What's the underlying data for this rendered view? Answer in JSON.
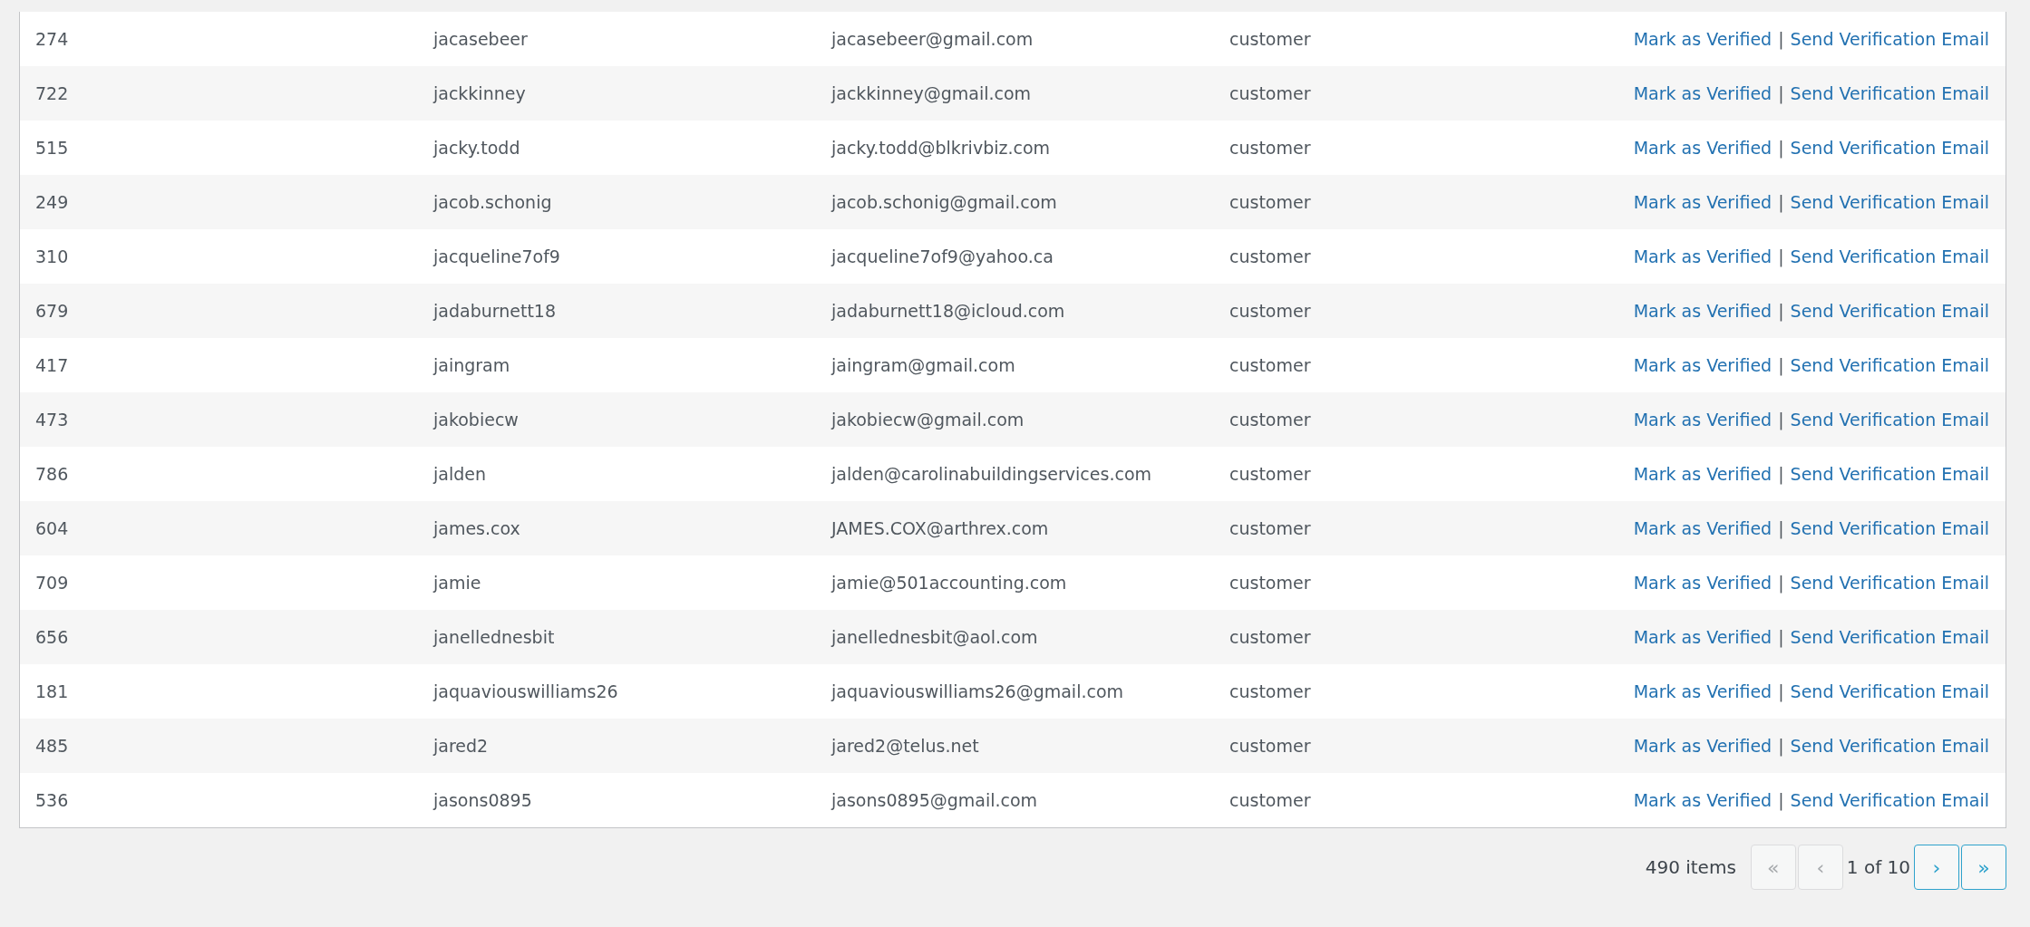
{
  "table": {
    "rows": [
      {
        "id": "274",
        "username": "jacasebeer",
        "email": "jacasebeer@gmail.com",
        "role": "customer",
        "actions": [
          "Mark as Verified",
          "Send Verification Email"
        ],
        "separator": "|"
      },
      {
        "id": "722",
        "username": "jackkinney",
        "email": "jackkinney@gmail.com",
        "role": "customer",
        "actions": [
          "Mark as Verified",
          "Send Verification Email"
        ],
        "separator": "|"
      },
      {
        "id": "515",
        "username": "jacky.todd",
        "email": "jacky.todd@blkrivbiz.com",
        "role": "customer",
        "actions": [
          "Mark as Verified",
          "Send Verification Email"
        ],
        "separator": "|"
      },
      {
        "id": "249",
        "username": "jacob.schonig",
        "email": "jacob.schonig@gmail.com",
        "role": "customer",
        "actions": [
          "Mark as Verified",
          "Send Verification Email"
        ],
        "separator": "|"
      },
      {
        "id": "310",
        "username": "jacqueline7of9",
        "email": "jacqueline7of9@yahoo.ca",
        "role": "customer",
        "actions": [
          "Mark as Verified",
          "Send Verification Email"
        ],
        "separator": "|"
      },
      {
        "id": "679",
        "username": "jadaburnett18",
        "email": "jadaburnett18@icloud.com",
        "role": "customer",
        "actions": [
          "Mark as Verified",
          "Send Verification Email"
        ],
        "separator": "|"
      },
      {
        "id": "417",
        "username": "jaingram",
        "email": "jaingram@gmail.com",
        "role": "customer",
        "actions": [
          "Mark as Verified",
          "Send Verification Email"
        ],
        "separator": "|"
      },
      {
        "id": "473",
        "username": "jakobiecw",
        "email": "jakobiecw@gmail.com",
        "role": "customer",
        "actions": [
          "Mark as Verified",
          "Send Verification Email"
        ],
        "separator": "|"
      },
      {
        "id": "786",
        "username": "jalden",
        "email": "jalden@carolinabuildingservices.com",
        "role": "customer",
        "actions": [
          "Mark as Verified",
          "Send Verification Email"
        ],
        "separator": "|"
      },
      {
        "id": "604",
        "username": "james.cox",
        "email": "JAMES.COX@arthrex.com",
        "role": "customer",
        "actions": [
          "Mark as Verified",
          "Send Verification Email"
        ],
        "separator": "|"
      },
      {
        "id": "709",
        "username": "jamie",
        "email": "jamie@501accounting.com",
        "role": "customer",
        "actions": [
          "Mark as Verified",
          "Send Verification Email"
        ],
        "separator": "|"
      },
      {
        "id": "656",
        "username": "janellednesbit",
        "email": "janellednesbit@aol.com",
        "role": "customer",
        "actions": [
          "Mark as Verified",
          "Send Verification Email"
        ],
        "separator": "|"
      },
      {
        "id": "181",
        "username": "jaquaviouswilliams26",
        "email": "jaquaviouswilliams26@gmail.com",
        "role": "customer",
        "actions": [
          "Mark as Verified",
          "Send Verification Email"
        ],
        "separator": "|"
      },
      {
        "id": "485",
        "username": "jared2",
        "email": "jared2@telus.net",
        "role": "customer",
        "actions": [
          "Mark as Verified",
          "Send Verification Email"
        ],
        "separator": "|"
      },
      {
        "id": "536",
        "username": "jasons0895",
        "email": "jasons0895@gmail.com",
        "role": "customer",
        "actions": [
          "Mark as Verified",
          "Send Verification Email"
        ],
        "separator": "|"
      }
    ]
  },
  "pagination": {
    "count": "490 items",
    "page": "1 of 10",
    "buttons": [
      {
        "label": "«",
        "kind": "first",
        "disabled": true
      },
      {
        "label": "‹",
        "kind": "prev",
        "disabled": true
      },
      {
        "label": "›",
        "kind": "next",
        "disabled": false
      },
      {
        "label": "»",
        "kind": "last",
        "disabled": false
      }
    ]
  }
}
